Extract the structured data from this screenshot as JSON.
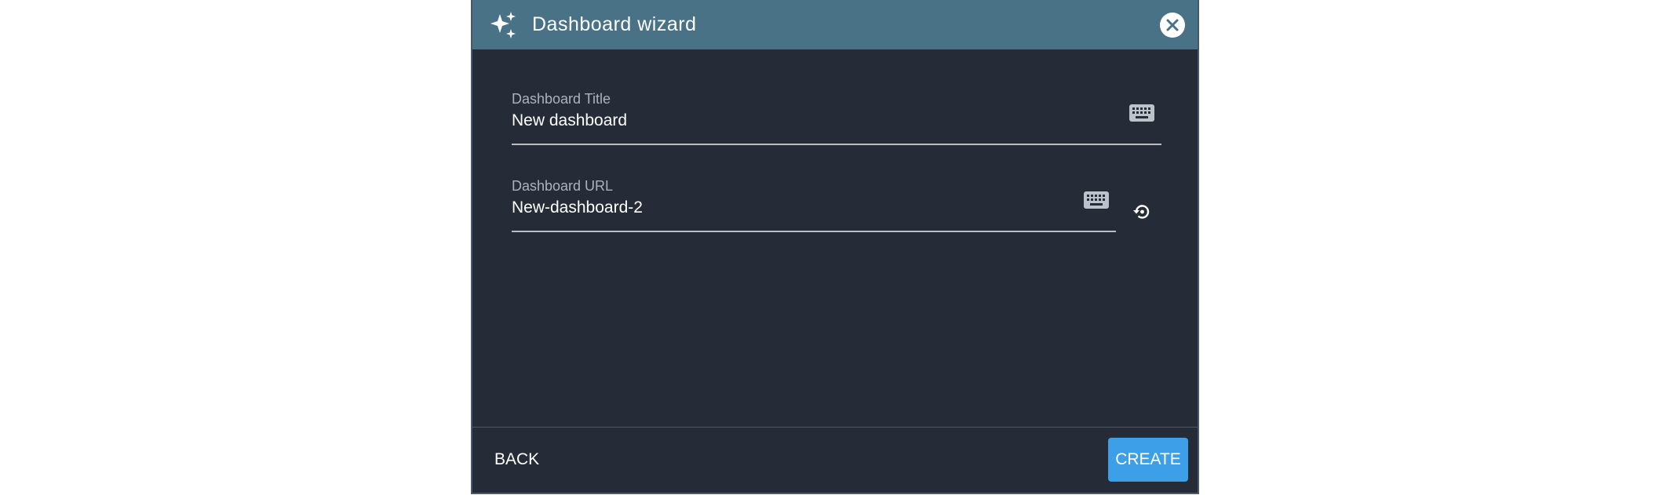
{
  "dialog": {
    "title": "Dashboard wizard",
    "header_icon": "sparkles-icon",
    "close_icon": "close-icon"
  },
  "fields": {
    "title": {
      "label": "Dashboard Title",
      "value": "New dashboard",
      "icon": "keyboard-icon"
    },
    "url": {
      "label": "Dashboard URL",
      "value": "New-dashboard-2",
      "icon": "keyboard-icon",
      "action_icon": "restore-icon"
    }
  },
  "footer": {
    "back_label": "BACK",
    "create_label": "CREATE"
  },
  "colors": {
    "header": "#4a7286",
    "body": "#252c38",
    "primary": "#3d9fe8"
  }
}
